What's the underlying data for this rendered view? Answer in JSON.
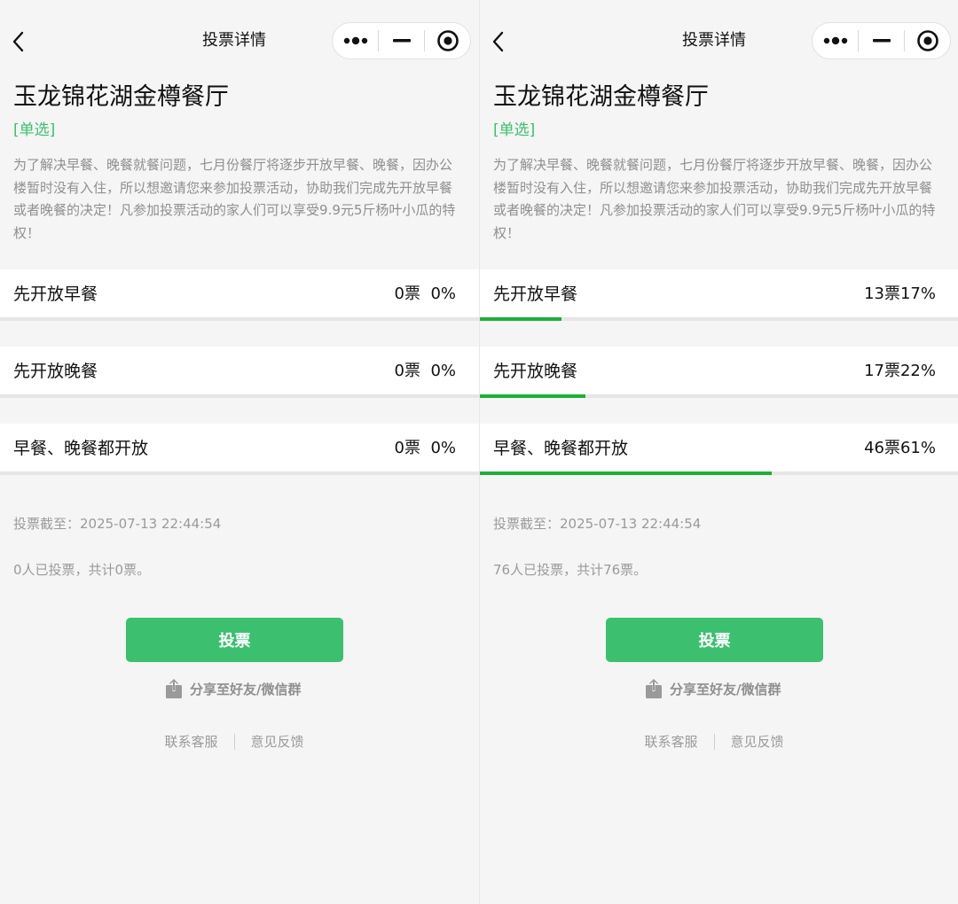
{
  "colors": {
    "accent": "#3cc06f",
    "progress": "#1fae3a",
    "muted_text": "#9a9a9a"
  },
  "panels": [
    {
      "nav_title": "投票详情",
      "title": "玉龙锦花湖金樽餐厅",
      "type_tag": "[单选]",
      "description": "为了解决早餐、晚餐就餐问题，七月份餐厅将逐步开放早餐、晚餐，因办公楼暂时没有入住，所以想邀请您来参加投票活动，协助我们完成先开放早餐或者晚餐的决定！凡参加投票活动的家人们可以享受9.9元5斤杨叶小瓜的特权！",
      "options": [
        {
          "label": "先开放早餐",
          "votes": "0票",
          "percent": "0%",
          "share": 0
        },
        {
          "label": "先开放晚餐",
          "votes": "0票",
          "percent": "0%",
          "share": 0
        },
        {
          "label": "早餐、晚餐都开放",
          "votes": "0票",
          "percent": "0%",
          "share": 0
        }
      ],
      "deadline": "投票截至：2025-07-13 22:44:54",
      "summary": "0人已投票，共计0票。",
      "vote_button": "投票",
      "share_text": "分享至好友/微信群",
      "footer": {
        "service": "联系客服",
        "feedback": "意见反馈"
      }
    },
    {
      "nav_title": "投票详情",
      "title": "玉龙锦花湖金樽餐厅",
      "type_tag": "[单选]",
      "description": "为了解决早餐、晚餐就餐问题，七月份餐厅将逐步开放早餐、晚餐，因办公楼暂时没有入住，所以想邀请您来参加投票活动，协助我们完成先开放早餐或者晚餐的决定！凡参加投票活动的家人们可以享受9.9元5斤杨叶小瓜的特权！",
      "options": [
        {
          "label": "先开放早餐",
          "votes": "13票",
          "percent": "17%",
          "share": 0.17
        },
        {
          "label": "先开放晚餐",
          "votes": "17票",
          "percent": "22%",
          "share": 0.22
        },
        {
          "label": "早餐、晚餐都开放",
          "votes": "46票",
          "percent": "61%",
          "share": 0.61
        }
      ],
      "deadline": "投票截至：2025-07-13 22:44:54",
      "summary": "76人已投票，共计76票。",
      "vote_button": "投票",
      "share_text": "分享至好友/微信群",
      "footer": {
        "service": "联系客服",
        "feedback": "意见反馈"
      }
    }
  ]
}
